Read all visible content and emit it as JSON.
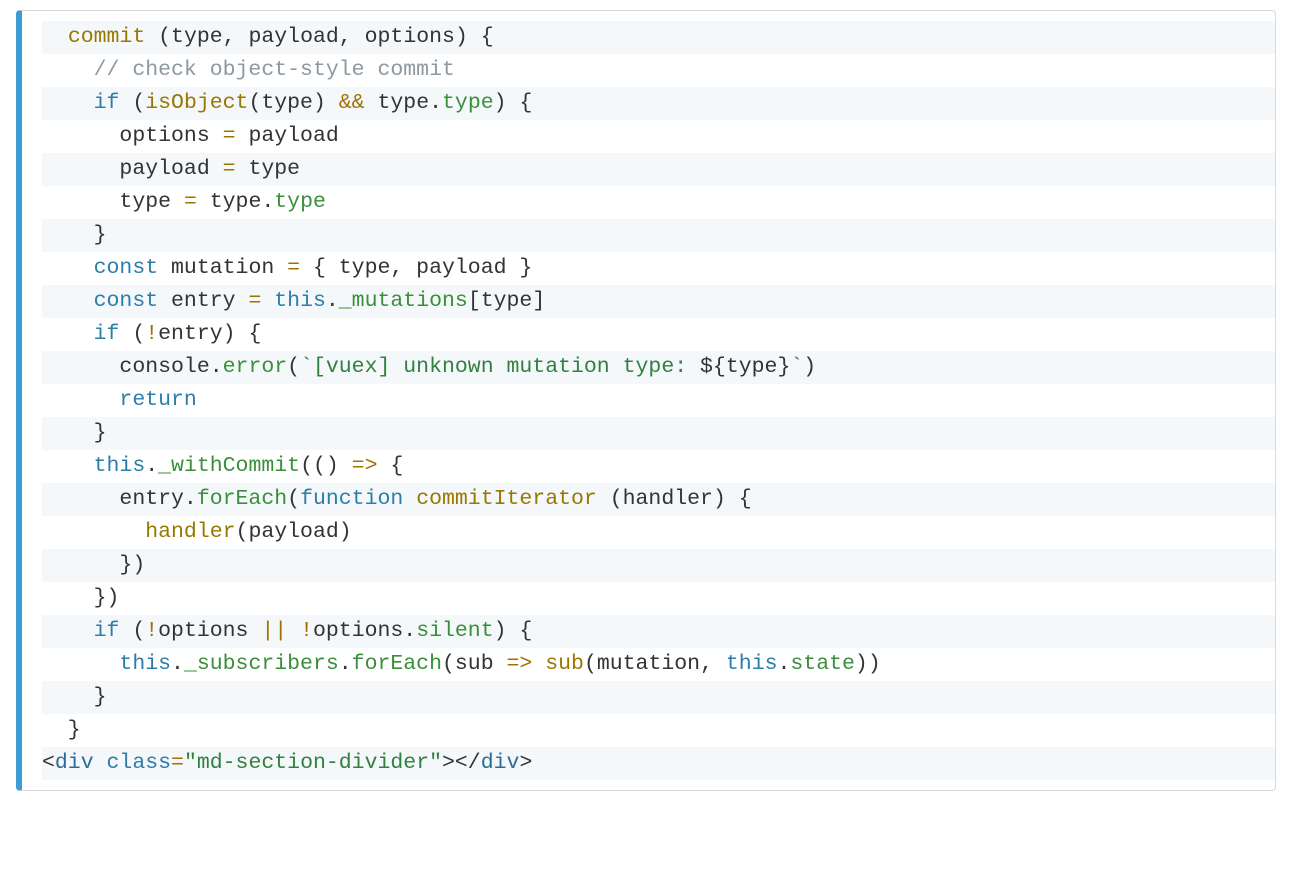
{
  "code": {
    "lines": [
      [
        [
          "p",
          "  "
        ],
        [
          "d",
          "commit"
        ],
        [
          "p",
          " ("
        ],
        [
          "p",
          "type"
        ],
        [
          "p",
          ", "
        ],
        [
          "p",
          "payload"
        ],
        [
          "p",
          ", "
        ],
        [
          "p",
          "options"
        ],
        [
          "p",
          ") {"
        ]
      ],
      [
        [
          "p",
          "    "
        ],
        [
          "c",
          "// check object-style commit"
        ]
      ],
      [
        [
          "p",
          "    "
        ],
        [
          "k",
          "if"
        ],
        [
          "p",
          " ("
        ],
        [
          "d",
          "isObject"
        ],
        [
          "p",
          "(type) "
        ],
        [
          "o",
          "&&"
        ],
        [
          "p",
          " type."
        ],
        [
          "m",
          "type"
        ],
        [
          "p",
          ") {"
        ]
      ],
      [
        [
          "p",
          "      options "
        ],
        [
          "o",
          "="
        ],
        [
          "p",
          " payload"
        ]
      ],
      [
        [
          "p",
          "      payload "
        ],
        [
          "o",
          "="
        ],
        [
          "p",
          " type"
        ]
      ],
      [
        [
          "p",
          "      type "
        ],
        [
          "o",
          "="
        ],
        [
          "p",
          " type."
        ],
        [
          "m",
          "type"
        ]
      ],
      [
        [
          "p",
          "    }"
        ]
      ],
      [
        [
          "p",
          "    "
        ],
        [
          "k",
          "const"
        ],
        [
          "p",
          " mutation "
        ],
        [
          "o",
          "="
        ],
        [
          "p",
          " { type, payload }"
        ]
      ],
      [
        [
          "p",
          "    "
        ],
        [
          "k",
          "const"
        ],
        [
          "p",
          " entry "
        ],
        [
          "o",
          "="
        ],
        [
          "p",
          " "
        ],
        [
          "k",
          "this"
        ],
        [
          "p",
          "."
        ],
        [
          "m",
          "_mutations"
        ],
        [
          "p",
          "[type]"
        ]
      ],
      [
        [
          "p",
          "    "
        ],
        [
          "k",
          "if"
        ],
        [
          "p",
          " ("
        ],
        [
          "o",
          "!"
        ],
        [
          "p",
          "entry) {"
        ]
      ],
      [
        [
          "p",
          "      console."
        ],
        [
          "m",
          "error"
        ],
        [
          "p",
          "("
        ],
        [
          "s",
          "`[vuex] unknown mutation type: "
        ],
        [
          "p",
          "${"
        ],
        [
          "p",
          "type"
        ],
        [
          "p",
          "}"
        ],
        [
          "s",
          "`"
        ],
        [
          "p",
          ")"
        ]
      ],
      [
        [
          "p",
          "      "
        ],
        [
          "k",
          "return"
        ]
      ],
      [
        [
          "p",
          "    }"
        ]
      ],
      [
        [
          "p",
          "    "
        ],
        [
          "k",
          "this"
        ],
        [
          "p",
          "."
        ],
        [
          "m",
          "_withCommit"
        ],
        [
          "p",
          "(() "
        ],
        [
          "o",
          "=>"
        ],
        [
          "p",
          " {"
        ]
      ],
      [
        [
          "p",
          "      entry."
        ],
        [
          "m",
          "forEach"
        ],
        [
          "p",
          "("
        ],
        [
          "k",
          "function"
        ],
        [
          "p",
          " "
        ],
        [
          "d",
          "commitIterator"
        ],
        [
          "p",
          " (handler) {"
        ]
      ],
      [
        [
          "p",
          "        "
        ],
        [
          "d",
          "handler"
        ],
        [
          "p",
          "(payload)"
        ]
      ],
      [
        [
          "p",
          "      })"
        ]
      ],
      [
        [
          "p",
          "    })"
        ]
      ],
      [
        [
          "p",
          "    "
        ],
        [
          "k",
          "if"
        ],
        [
          "p",
          " ("
        ],
        [
          "o",
          "!"
        ],
        [
          "p",
          "options "
        ],
        [
          "o",
          "||"
        ],
        [
          "p",
          " "
        ],
        [
          "o",
          "!"
        ],
        [
          "p",
          "options."
        ],
        [
          "m",
          "silent"
        ],
        [
          "p",
          ") {"
        ]
      ],
      [
        [
          "p",
          "      "
        ],
        [
          "k",
          "this"
        ],
        [
          "p",
          "."
        ],
        [
          "m",
          "_subscribers"
        ],
        [
          "p",
          "."
        ],
        [
          "m",
          "forEach"
        ],
        [
          "p",
          "(sub "
        ],
        [
          "o",
          "=>"
        ],
        [
          "p",
          " "
        ],
        [
          "d",
          "sub"
        ],
        [
          "p",
          "(mutation, "
        ],
        [
          "k",
          "this"
        ],
        [
          "p",
          "."
        ],
        [
          "m",
          "state"
        ],
        [
          "p",
          "))"
        ]
      ],
      [
        [
          "p",
          "    }"
        ]
      ],
      [
        [
          "p",
          "  }"
        ]
      ],
      [
        [
          "p",
          "<"
        ],
        [
          "t",
          "div"
        ],
        [
          "p",
          " "
        ],
        [
          "k",
          "class"
        ],
        [
          "o",
          "="
        ],
        [
          "s",
          "\"md-section-divider\""
        ],
        [
          "p",
          "></"
        ],
        [
          "t",
          "div"
        ],
        [
          "p",
          ">"
        ]
      ]
    ]
  }
}
